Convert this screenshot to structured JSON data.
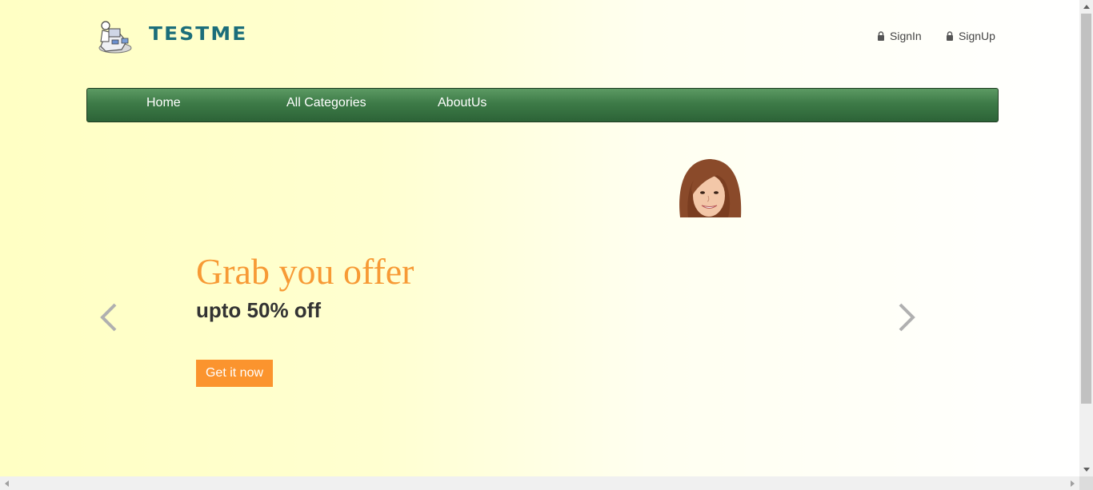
{
  "header": {
    "brand": "TESTME",
    "logo": "computer-user-illustration",
    "auth_links": [
      {
        "label": "SignIn",
        "icon": "lock-icon"
      },
      {
        "label": "SignUp",
        "icon": "lock-icon"
      }
    ]
  },
  "nav": {
    "items": [
      "Home",
      "All Categories",
      "AboutUs"
    ]
  },
  "hero": {
    "headline": "Grab you offer",
    "subheadline": "upto 50% off",
    "cta_label": "Get it now",
    "image": "smiling-woman-photo",
    "prev_icon": "chevron-left-icon",
    "next_icon": "chevron-right-icon"
  },
  "colors": {
    "accent": "#f79a35",
    "button": "#fb942e",
    "nav": "#3d7a47",
    "brand": "#1b6e7a"
  }
}
